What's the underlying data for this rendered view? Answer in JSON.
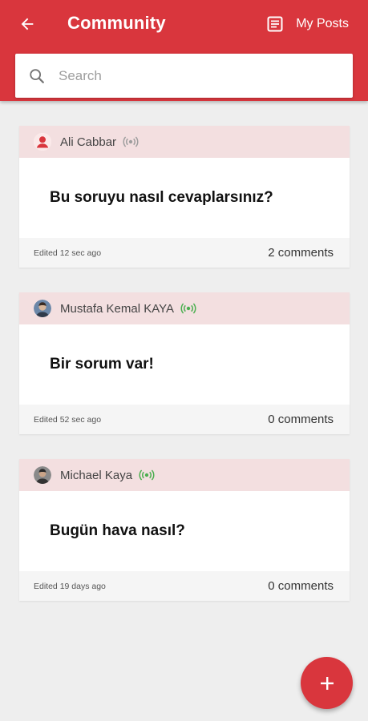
{
  "header": {
    "title": "Community",
    "my_posts_label": "My Posts",
    "back_icon": "arrow-left-icon",
    "my_posts_icon": "document-list-icon"
  },
  "search": {
    "placeholder": "Search",
    "value": ""
  },
  "posts": [
    {
      "author": "Ali Cabbar",
      "avatar_icon": "user-icon",
      "online": false,
      "question": "Bu soruyu nasıl cevaplarsınız?",
      "edited": "Edited 12 sec ago",
      "comments": "2 comments"
    },
    {
      "author": "Mustafa Kemal KAYA",
      "avatar_icon": "profile-photo",
      "online": true,
      "question": "Bir sorum var!",
      "edited": "Edited 52 sec ago",
      "comments": "0 comments"
    },
    {
      "author": "Michael Kaya",
      "avatar_icon": "profile-photo",
      "online": true,
      "question": "Bugün hava nasıl?",
      "edited": "Edited 19 days ago",
      "comments": "0 comments"
    }
  ],
  "fab": {
    "icon": "plus-icon"
  },
  "colors": {
    "primary": "#d9363d",
    "card_header": "#f3dfe0",
    "online": "#4caf50",
    "offline": "#9e9e9e"
  }
}
